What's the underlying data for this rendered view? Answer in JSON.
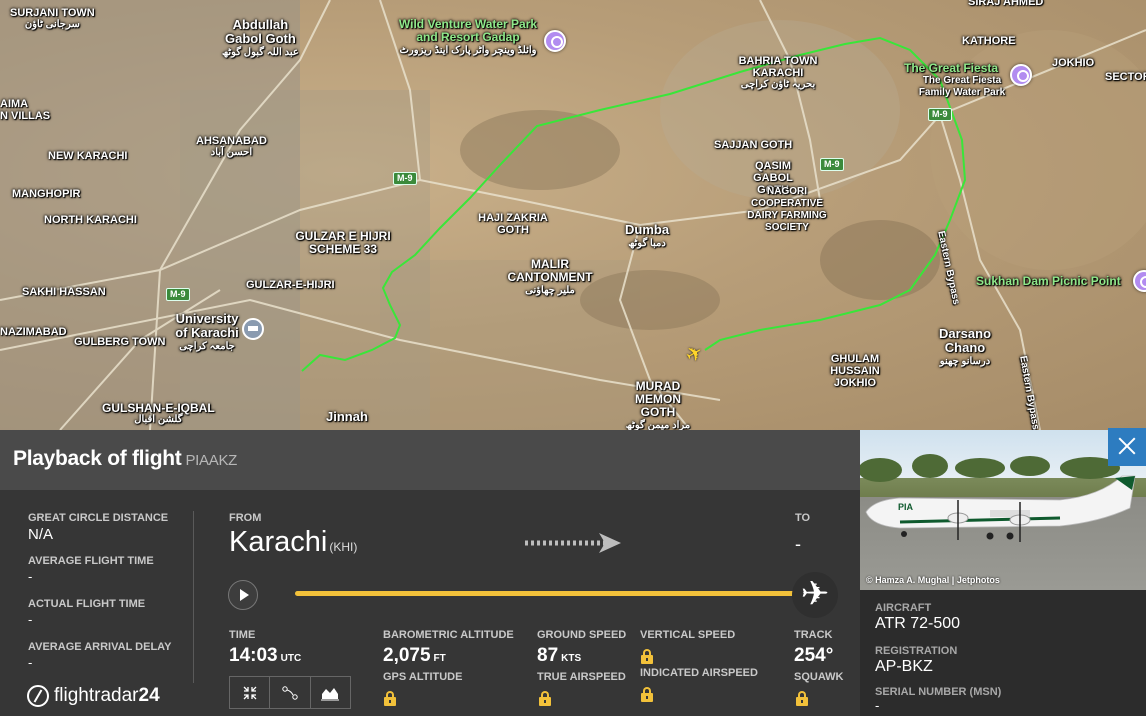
{
  "map": {
    "labels": {
      "surjani": "SURJANI TOWN",
      "surjani_ur": "سرجانی ٹاؤن",
      "abdullah": "Abdullah\nGabol Goth",
      "abdullah_ur": "عبد اللہ گبول گوٹھ",
      "wildventure": "Wild Venture Water Park and Resort Gadap",
      "wildventure_ur": "وائلڈ وینچر واٹر پارک اینڈ ریزورٹ",
      "bahria": "BAHRIA TOWN KARACHI",
      "bahria_ur": "بحریہ ٹاؤن کراچی",
      "kathore": "KATHORE",
      "jokhio": "JOKHIO",
      "greatfiesta": "The Great Fiesta",
      "greatfiesta_sub": "The Great Fiesta Family Water Park",
      "sector": "SECTOR",
      "sirajahmed": "SIRAJ AHMED",
      "ahsanabad": "AHSANABAD",
      "ahsanabad_ur": "احسن آباد",
      "newkarachi": "NEW KARACHI",
      "manghopir": "MANGHOPIR",
      "northkarachi": "NORTH KARACHI",
      "gulzarhijri": "GULZAR E HIJRI SCHEME 33",
      "gulzarehijri": "GULZAR-E-HIJRI",
      "hajizakria": "HAJI ZAKRIA GOTH",
      "malir": "MALIR CANTONMENT",
      "malir_ur": "ملیر چھاؤنی",
      "dumba": "Dumba",
      "dumba_ur": "دمبا گوٹھ",
      "sajjan": "SAJJAN GOTH",
      "qasim": "QASIM GABOL GOTH",
      "nagori": "NAGORI COOPERATIVE DAIRY FARMING SOCIETY",
      "sukhan": "Sukhan Dam Picnic Point",
      "darsano": "Darsano Chano",
      "darsano_ur": "درسانو چھنو",
      "ghulam": "GHULAM HUSSAIN JOKHIO",
      "murad": "MURAD MEMON GOTH",
      "murad_ur": "مراد میمن گوٹھ",
      "sakhi": "SAKHI HASSAN",
      "gulberg": "GULBERG TOWN",
      "university": "University of Karachi",
      "university_ur": "جامعہ کراچی",
      "gulshan": "GULSHAN-E-IQBAL",
      "gulshan_ur": "گلشن اقبال",
      "jinnah": "Jinnah",
      "aima": "AIMA",
      "nvillas": "N VILLAS",
      "nzimabad": "NAZIMABAD",
      "eastern1": "Eastern Bypass",
      "eastern2": "Eastern Bypass",
      "m9a": "M-9",
      "m9b": "M-9",
      "m9c": "M-9",
      "m9d": "M-9"
    }
  },
  "header": {
    "title": "Playback of flight",
    "flight_code": "PIAAKZ"
  },
  "stats": {
    "great_circle_label": "GREAT CIRCLE DISTANCE",
    "great_circle_value": "N/A",
    "avg_flight_label": "AVERAGE FLIGHT TIME",
    "avg_flight_value": "-",
    "actual_flight_label": "ACTUAL FLIGHT TIME",
    "actual_flight_value": "-",
    "avg_delay_label": "AVERAGE ARRIVAL DELAY",
    "avg_delay_value": "-"
  },
  "route": {
    "from_label": "FROM",
    "from_city": "Karachi",
    "from_code": "(KHI)",
    "to_label": "TO",
    "to_city": "-"
  },
  "playback": {
    "progress": 0.97
  },
  "metrics": {
    "time_label": "TIME",
    "time_value": "14:03",
    "time_unit": "UTC",
    "baro_label": "BAROMETRIC ALTITUDE",
    "baro_value": "2,075",
    "baro_unit": "FT",
    "gps_label": "GPS ALTITUDE",
    "ground_label": "GROUND SPEED",
    "ground_value": "87",
    "ground_unit": "KTS",
    "tas_label": "TRUE AIRSPEED",
    "vs_label": "VERTICAL SPEED",
    "ias_label": "INDICATED AIRSPEED",
    "track_label": "TRACK",
    "track_value": "254°",
    "squawk_label": "SQUAWK"
  },
  "logo": {
    "text": "flightradar",
    "num": "24"
  },
  "aircraft": {
    "photo_credit": "© Hamza A. Mughal | Jetphotos",
    "aircraft_label": "AIRCRAFT",
    "aircraft_value": "ATR 72-500",
    "registration_label": "REGISTRATION",
    "registration_value": "AP-BKZ",
    "msn_label": "SERIAL NUMBER (MSN)",
    "msn_value": "-"
  },
  "colors": {
    "flight_path": "#39e639",
    "progress": "#f2c13a",
    "close_button": "#2d7cc0"
  }
}
